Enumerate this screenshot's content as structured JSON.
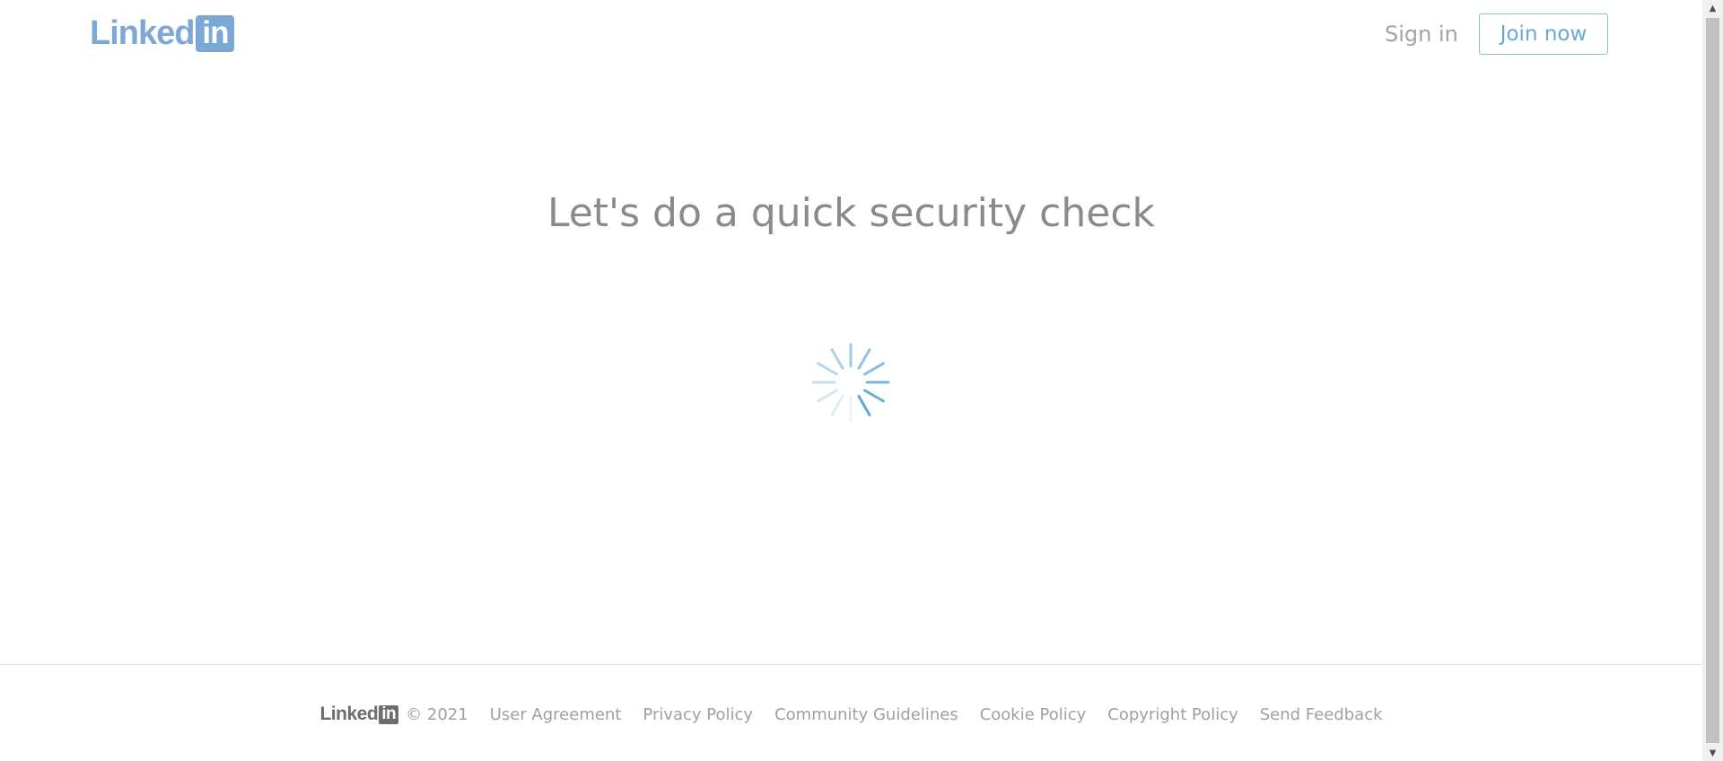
{
  "header": {
    "logo_text": "Linked",
    "logo_box_text": "in",
    "sign_in_label": "Sign in",
    "join_now_label": "Join now"
  },
  "main": {
    "headline": "Let's do a quick security check"
  },
  "footer": {
    "logo_text": "Linked",
    "logo_box_text": "in",
    "copyright": "© 2021",
    "links": [
      "User Agreement",
      "Privacy Policy",
      "Community Guidelines",
      "Cookie Policy",
      "Copyright Policy",
      "Send Feedback"
    ]
  },
  "colors": {
    "brand_blue": "#7da8d6",
    "spinner_blue": "#5aa9d6",
    "text_gray": "#8a8a8a"
  },
  "icons": {
    "spinner": "loading-spinner-icon",
    "scroll_up": "scroll-up-arrow-icon",
    "scroll_down": "scroll-down-arrow-icon"
  }
}
